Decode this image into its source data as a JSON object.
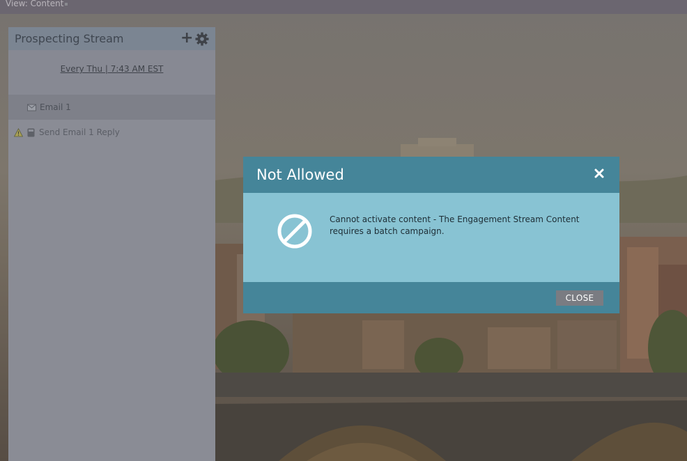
{
  "view_bar": {
    "label": "View: Content"
  },
  "stream_panel": {
    "title": "Prospecting Stream",
    "add_icon": "plus-icon",
    "settings_icon": "gear-icon",
    "schedule": "Every Thu | 7:43 AM EST",
    "items": [
      {
        "label": "Email 1",
        "icon": "email-icon",
        "warning": false
      },
      {
        "label": "Send Email 1 Reply",
        "icon": "campaign-icon",
        "warning": true
      }
    ]
  },
  "modal": {
    "title": "Not Allowed",
    "message": "Cannot activate content - The Engagement Stream Content requires a batch campaign.",
    "close_button_label": "CLOSE",
    "icon": "no-entry-icon",
    "colors": {
      "header": "#458599",
      "body": "#88c3d3",
      "button": "#7a7c82"
    }
  }
}
